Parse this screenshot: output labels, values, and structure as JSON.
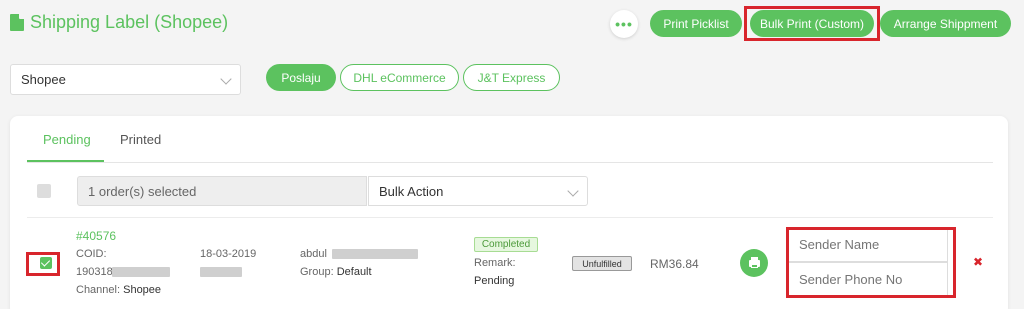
{
  "page": {
    "title": "Shipping Label (Shopee)",
    "more_label": "•••"
  },
  "toolbar": {
    "print_picklist": "Print Picklist",
    "bulk_print_custom": "Bulk Print (Custom)",
    "arrange_shipment": "Arrange Shippment"
  },
  "channel_select": {
    "value": "Shopee"
  },
  "couriers": [
    "Poslaju",
    "DHL eCommerce",
    "J&T Express"
  ],
  "tabs": {
    "pending": "Pending",
    "printed": "Printed"
  },
  "selection": {
    "summary": "1 order(s) selected",
    "bulk_action": "Bulk Action"
  },
  "order": {
    "id": "#40576",
    "coid_label": "COID:",
    "coid_prefix": "190318",
    "channel_label": "Channel:",
    "channel": "Shopee",
    "date": "18-03-2019",
    "customer_first": "abdul",
    "group_label": "Group:",
    "group": "Default",
    "status": "Completed",
    "remark_label": "Remark:",
    "remark": "Pending",
    "fulfillment": "Unfulfilled",
    "amount": "RM36.84",
    "sender_name_placeholder": "Sender Name",
    "sender_phone_placeholder": "Sender Phone No",
    "remove_label": "✖"
  },
  "colors": {
    "accent": "#5cc25f",
    "highlight": "#d8252c"
  }
}
